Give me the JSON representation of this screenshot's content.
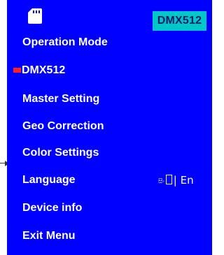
{
  "header": {
    "icon": "sd-card-icon",
    "current_mode": "DMX512"
  },
  "menu": {
    "items": [
      {
        "label": "Operation Mode"
      },
      {
        "label": "DMX512",
        "selected": true
      },
      {
        "label": "Master Setting"
      },
      {
        "label": "Geo Correction"
      },
      {
        "label": "Color Settings"
      },
      {
        "label": "Language"
      },
      {
        "label": "Device info"
      },
      {
        "label": "Exit Menu"
      }
    ]
  },
  "language": {
    "alt_script": "සිං",
    "separator": "| En"
  },
  "colors": {
    "background": "#0000ff",
    "badge": "#00c8c8",
    "selection_marker": "#ff2020",
    "text": "#ffffff"
  }
}
